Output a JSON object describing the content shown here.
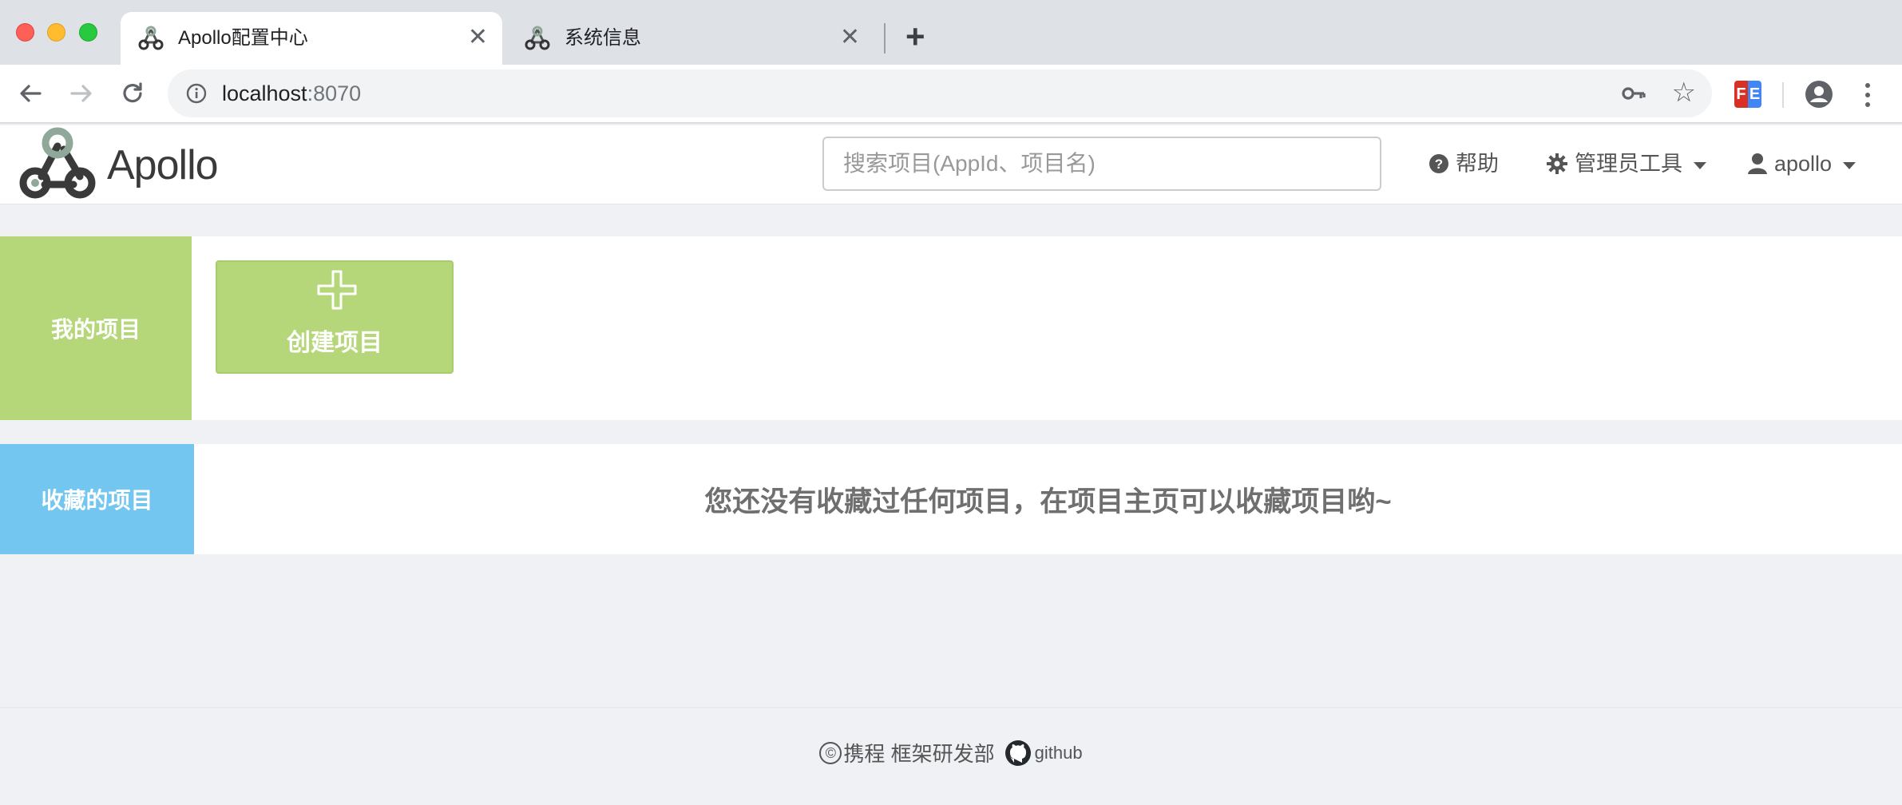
{
  "browser": {
    "tabs": [
      {
        "title": "Apollo配置中心",
        "active": true
      },
      {
        "title": "系统信息",
        "active": false
      }
    ],
    "new_tab": "+",
    "url_host": "localhost",
    "url_port": ":8070",
    "extension": {
      "f": "F",
      "e": "E"
    }
  },
  "header": {
    "brand": "Apollo",
    "search_placeholder": "搜索项目(AppId、项目名)",
    "nav": {
      "help": "帮助",
      "admin_tools": "管理员工具",
      "user": "apollo"
    }
  },
  "my_projects": {
    "label": "我的项目",
    "create_label": "创建项目"
  },
  "favorites": {
    "label": "收藏的项目",
    "empty_message": "您还没有收藏过任何项目，在项目主页可以收藏项目哟~"
  },
  "footer": {
    "copyright": "©",
    "company": "携程 框架研发部",
    "github": "github"
  },
  "colors": {
    "my_projects": "#b5d77a",
    "favorites": "#73c6f0",
    "page_background": "#f0f1f5"
  }
}
